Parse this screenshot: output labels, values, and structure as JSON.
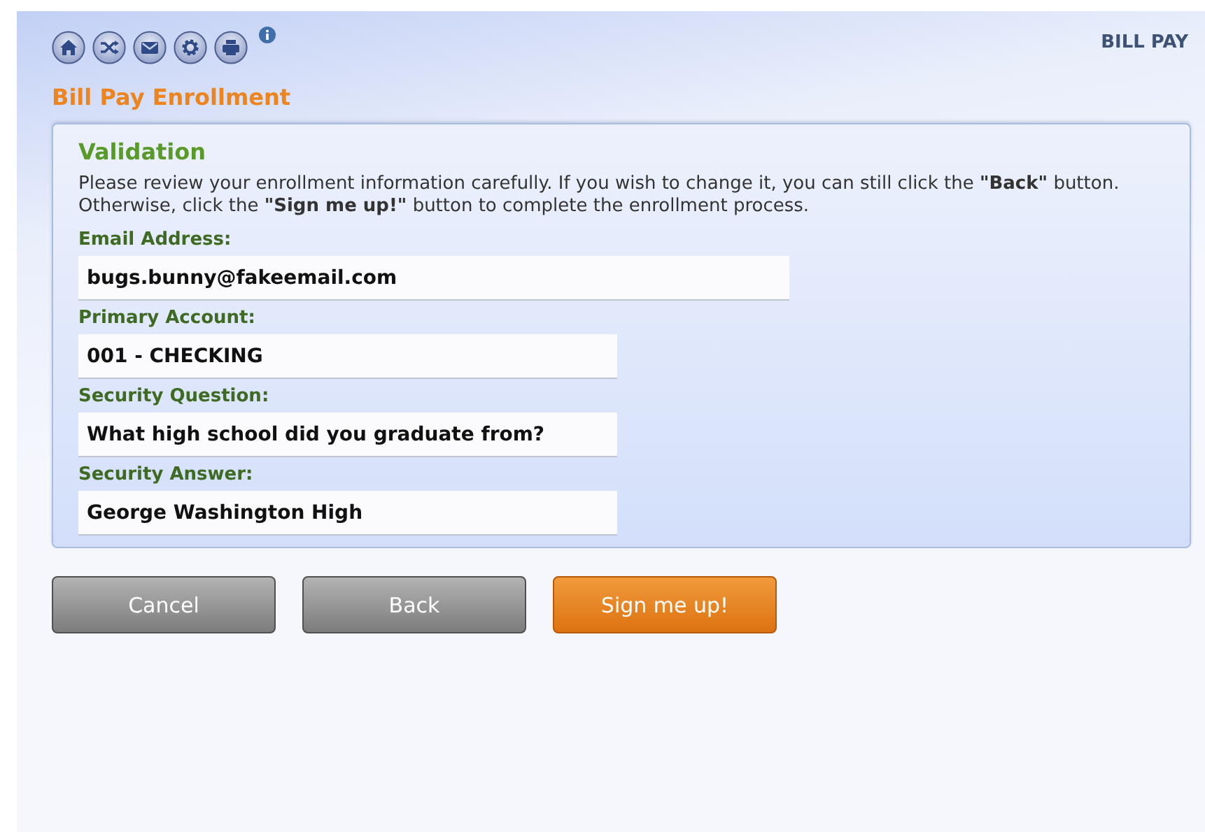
{
  "toolbar": {
    "icons": [
      {
        "kind": "home"
      },
      {
        "kind": "shuffle"
      },
      {
        "kind": "mail"
      },
      {
        "kind": "gear"
      },
      {
        "kind": "print"
      }
    ],
    "info": true
  },
  "section_label": "BILL PAY",
  "page_title": "Bill Pay Enrollment",
  "panel": {
    "heading": "Validation",
    "intro": "Please review your enrollment information carefully. If you wish to change it, you can still click the **\"Back\"** button. Otherwise, click the **\"Sign me up!\"** button to complete the enrollment process.",
    "fields": [
      {
        "label": "Email Address:",
        "value": "bugs.bunny@fakeemail.com",
        "kind": "wide"
      },
      {
        "label": "Primary Account:",
        "value": "001 - CHECKING",
        "kind": "narrow"
      },
      {
        "label": "Security Question:",
        "value": "What high school did you graduate from?",
        "kind": "narrow"
      },
      {
        "label": "Security Answer:",
        "value": "George Washington High",
        "kind": "narrow"
      }
    ]
  },
  "buttons": [
    {
      "label": "Cancel",
      "kind": "secondary"
    },
    {
      "label": "Back",
      "kind": "secondary"
    },
    {
      "label": "Sign me up!",
      "kind": "primary"
    }
  ]
}
